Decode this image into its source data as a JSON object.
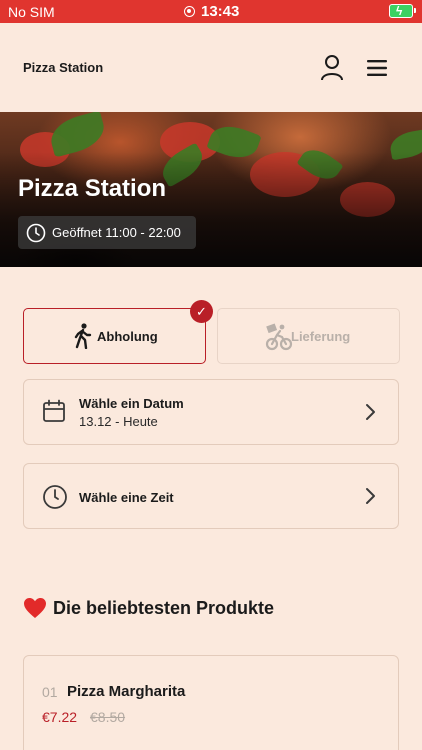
{
  "status_bar": {
    "carrier": "No SIM",
    "time": "13:43",
    "battery_color": "#3bd163"
  },
  "header": {
    "brand": "Pizza Station",
    "user_icon": "user-icon",
    "menu_icon": "hamburger-menu-icon"
  },
  "hero": {
    "title": "Pizza Station",
    "hours": "Geöffnet 11:00 - 22:00",
    "hours_icon": "clock-icon"
  },
  "order_mode": {
    "pickup_label": "Abholung",
    "delivery_label": "Lieferung",
    "selected": "pickup",
    "selected_check": "✓"
  },
  "date_selector": {
    "title": "Wähle ein Datum",
    "value": "13.12 - Heute",
    "icon": "calendar-icon"
  },
  "time_selector": {
    "title": "Wähle eine Zeit",
    "icon": "clock-icon"
  },
  "popular": {
    "heading": "Die beliebtesten Produkte",
    "products": [
      {
        "number": "01",
        "name": "Pizza Margharita",
        "price": "€7.22",
        "old_price": "€8.50"
      }
    ]
  },
  "colors": {
    "accent": "#b91f27",
    "status_bar": "#e0352f",
    "background": "#fbe9dd"
  }
}
